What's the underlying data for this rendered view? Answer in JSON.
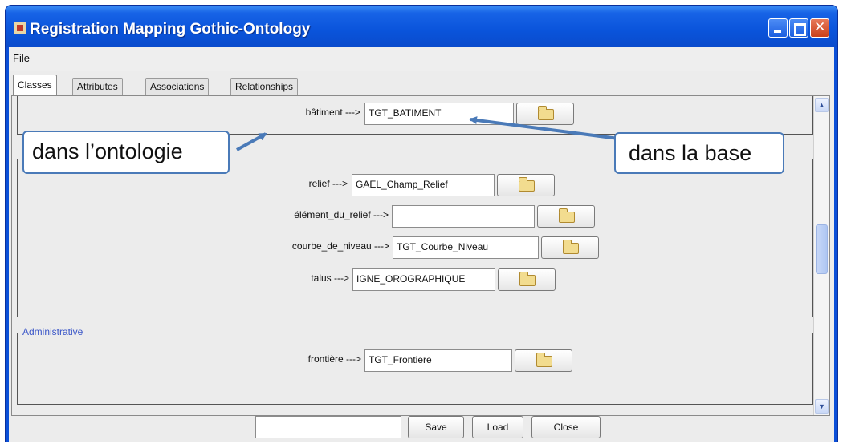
{
  "window": {
    "title": "Registration Mapping Gothic-Ontology"
  },
  "menu": {
    "file": "File"
  },
  "tabs": [
    "Classes",
    "Attributes",
    "Associations",
    "Relationships"
  ],
  "groups": {
    "administrative": "Administrative"
  },
  "rows": [
    {
      "label": "bâtiment --->",
      "value": "TGT_BATIMENT"
    },
    {
      "label": "relief --->",
      "value": "GAEL_Champ_Relief"
    },
    {
      "label": "élément_du_relief --->",
      "value": ""
    },
    {
      "label": "courbe_de_niveau --->",
      "value": "TGT_Courbe_Niveau"
    },
    {
      "label": "talus --->",
      "value": "IGNE_OROGRAPHIQUE"
    },
    {
      "label": "frontière --->",
      "value": "TGT_Frontiere"
    }
  ],
  "buttons": {
    "save": "Save",
    "load": "Load",
    "close": "Close"
  },
  "bottom_input": "",
  "callouts": {
    "ontology": "dans l’ontologie",
    "database": "dans la base"
  },
  "colors": {
    "title_bar": "#0a54db",
    "group_title": "#3a56c8",
    "callout_border": "#4a7ab8",
    "arrow": "#4a7ab8"
  },
  "icons": {
    "folder": "folder-icon",
    "minimize": "minimize-icon",
    "maximize": "maximize-icon",
    "close": "close-icon"
  }
}
